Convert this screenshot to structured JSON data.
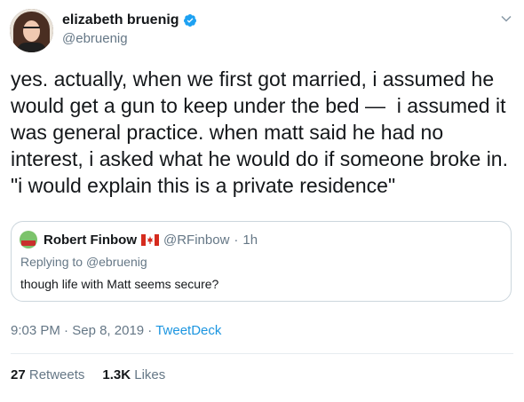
{
  "author": {
    "display_name": "elizabeth bruenig",
    "handle": "@ebruenig",
    "avatar_icon": "profile-photo-icon",
    "verified_icon": "verified-badge-icon"
  },
  "tweet": {
    "text": "yes. actually, when we first got married, i assumed he\nwould get a gun to keep under the bed —  i assumed it\nwas general practice. when matt said he had no\ninterest, i asked what he would do if someone broke in.\n\"i would explain this is a private residence\""
  },
  "quoted_tweet": {
    "display_name": "Robert Finbow",
    "flag_icon": "canada-flag-icon",
    "handle": "@RFinbow",
    "separator": "·",
    "time": "1h",
    "replying_prefix": "Replying to",
    "replying_to": "@ebruenig",
    "text": "though life with Matt seems secure?"
  },
  "meta": {
    "time": "9:03 PM",
    "separator1": "·",
    "date": "Sep 8, 2019",
    "separator2": "·",
    "source": "TweetDeck"
  },
  "stats": {
    "retweets_count": "27",
    "retweets_label": "Retweets",
    "likes_count": "1.3K",
    "likes_label": "Likes"
  },
  "colors": {
    "link": "#1b95e0",
    "secondary_text": "#657786",
    "border": "#ccd6dd",
    "verified": "#1da1f2"
  }
}
